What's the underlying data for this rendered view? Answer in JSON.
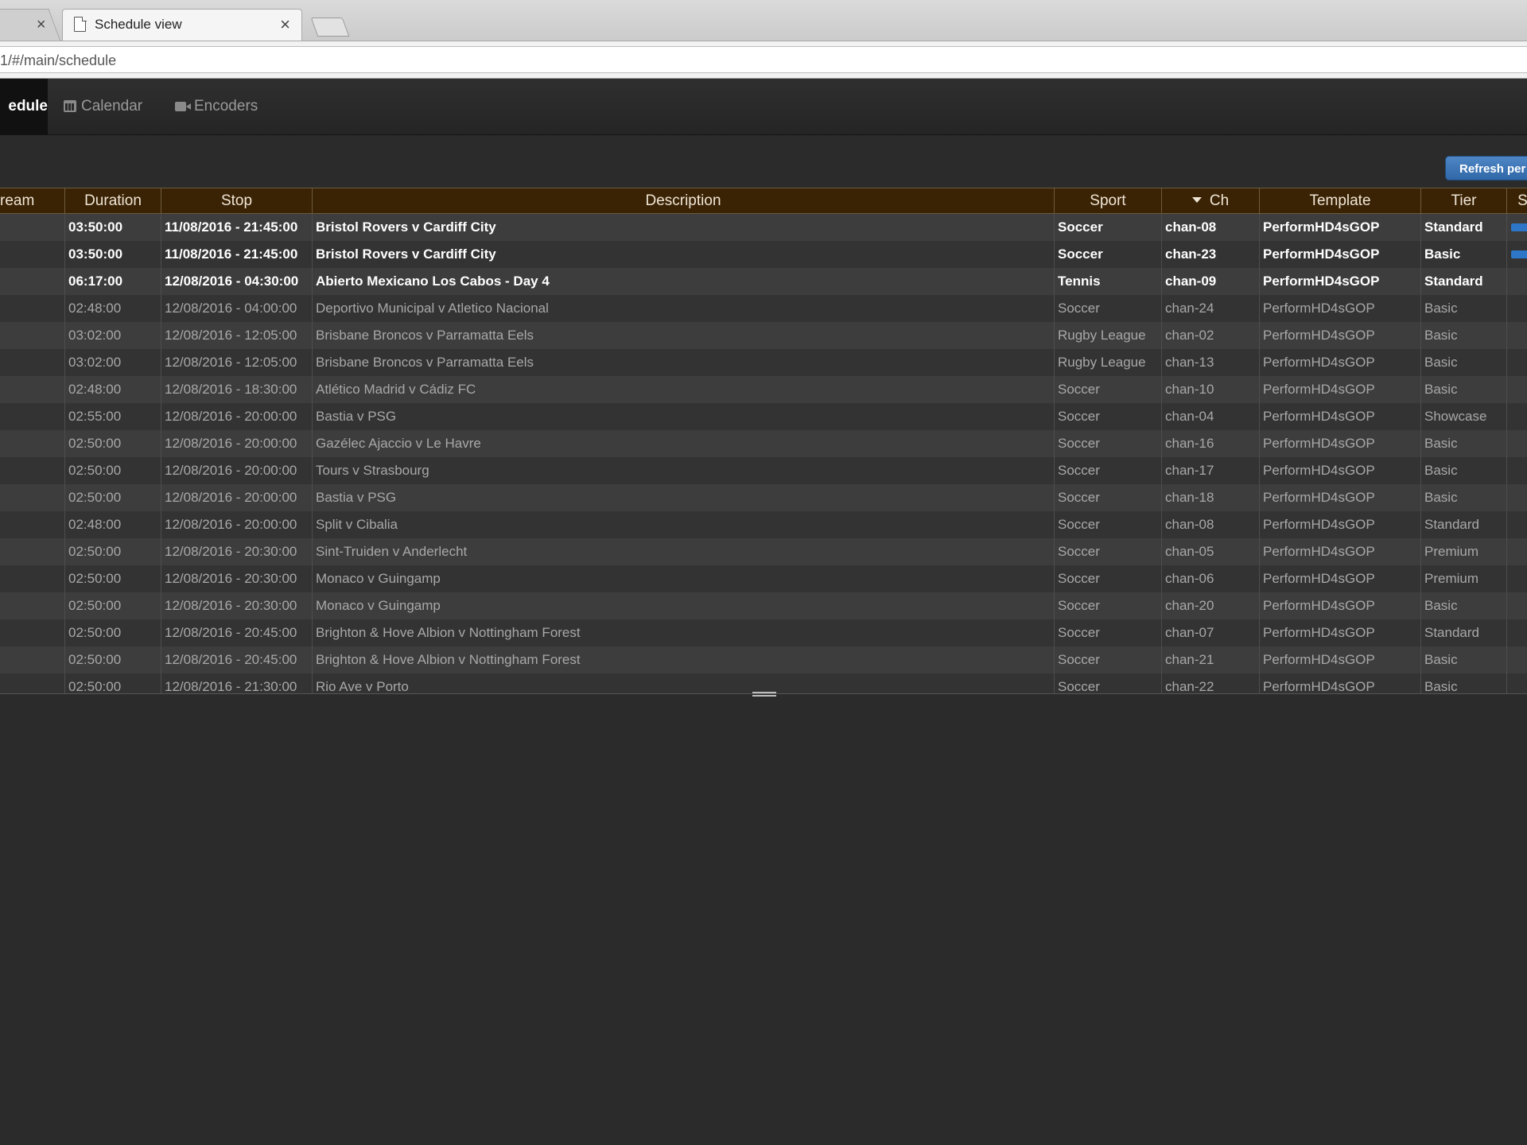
{
  "browser": {
    "tab_title": "Schedule view",
    "close_glyph": "×",
    "url": "1/#/main/schedule"
  },
  "nav": {
    "active": "edule",
    "calendar": "Calendar",
    "encoders": "Encoders",
    "calendar_icon": "calendar-icon",
    "encoders_icon": "video-camera-icon"
  },
  "toolbar": {
    "refresh_label": "Refresh per"
  },
  "table": {
    "headers": {
      "stream": "ream",
      "duration": "Duration",
      "stop": "Stop",
      "description": "Description",
      "sport": "Sport",
      "ch": "Ch",
      "template": "Template",
      "tier": "Tier",
      "s": "S"
    },
    "rows": [
      {
        "duration": "03:50:00",
        "stop": "11/08/2016 - 21:45:00",
        "description": "Bristol Rovers v Cardiff City",
        "sport": "Soccer",
        "ch": "chan-08",
        "template": "PerformHD4sGOP",
        "tier": "Standard"
      },
      {
        "duration": "03:50:00",
        "stop": "11/08/2016 - 21:45:00",
        "description": "Bristol Rovers v Cardiff City",
        "sport": "Soccer",
        "ch": "chan-23",
        "template": "PerformHD4sGOP",
        "tier": "Basic"
      },
      {
        "duration": "06:17:00",
        "stop": "12/08/2016 - 04:30:00",
        "description": "Abierto Mexicano Los Cabos - Day 4",
        "sport": "Tennis",
        "ch": "chan-09",
        "template": "PerformHD4sGOP",
        "tier": "Standard"
      },
      {
        "duration": "02:48:00",
        "stop": "12/08/2016 - 04:00:00",
        "description": "Deportivo Municipal v Atletico Nacional",
        "sport": "Soccer",
        "ch": "chan-24",
        "template": "PerformHD4sGOP",
        "tier": "Basic"
      },
      {
        "duration": "03:02:00",
        "stop": "12/08/2016 - 12:05:00",
        "description": "Brisbane Broncos v Parramatta Eels",
        "sport": "Rugby League",
        "ch": "chan-02",
        "template": "PerformHD4sGOP",
        "tier": "Basic"
      },
      {
        "duration": "03:02:00",
        "stop": "12/08/2016 - 12:05:00",
        "description": "Brisbane Broncos v Parramatta Eels",
        "sport": "Rugby League",
        "ch": "chan-13",
        "template": "PerformHD4sGOP",
        "tier": "Basic"
      },
      {
        "duration": "02:48:00",
        "stop": "12/08/2016 - 18:30:00",
        "description": "Atlético Madrid v Cádiz FC",
        "sport": "Soccer",
        "ch": "chan-10",
        "template": "PerformHD4sGOP",
        "tier": "Basic"
      },
      {
        "duration": "02:55:00",
        "stop": "12/08/2016 - 20:00:00",
        "description": "Bastia v PSG",
        "sport": "Soccer",
        "ch": "chan-04",
        "template": "PerformHD4sGOP",
        "tier": "Showcase"
      },
      {
        "duration": "02:50:00",
        "stop": "12/08/2016 - 20:00:00",
        "description": "Gazélec Ajaccio v Le Havre",
        "sport": "Soccer",
        "ch": "chan-16",
        "template": "PerformHD4sGOP",
        "tier": "Basic"
      },
      {
        "duration": "02:50:00",
        "stop": "12/08/2016 - 20:00:00",
        "description": "Tours v Strasbourg",
        "sport": "Soccer",
        "ch": "chan-17",
        "template": "PerformHD4sGOP",
        "tier": "Basic"
      },
      {
        "duration": "02:50:00",
        "stop": "12/08/2016 - 20:00:00",
        "description": "Bastia v PSG",
        "sport": "Soccer",
        "ch": "chan-18",
        "template": "PerformHD4sGOP",
        "tier": "Basic"
      },
      {
        "duration": "02:48:00",
        "stop": "12/08/2016 - 20:00:00",
        "description": "Split v Cibalia",
        "sport": "Soccer",
        "ch": "chan-08",
        "template": "PerformHD4sGOP",
        "tier": "Standard"
      },
      {
        "duration": "02:50:00",
        "stop": "12/08/2016 - 20:30:00",
        "description": "Sint-Truiden v Anderlecht",
        "sport": "Soccer",
        "ch": "chan-05",
        "template": "PerformHD4sGOP",
        "tier": "Premium"
      },
      {
        "duration": "02:50:00",
        "stop": "12/08/2016 - 20:30:00",
        "description": "Monaco v Guingamp",
        "sport": "Soccer",
        "ch": "chan-06",
        "template": "PerformHD4sGOP",
        "tier": "Premium"
      },
      {
        "duration": "02:50:00",
        "stop": "12/08/2016 - 20:30:00",
        "description": "Monaco v Guingamp",
        "sport": "Soccer",
        "ch": "chan-20",
        "template": "PerformHD4sGOP",
        "tier": "Basic"
      },
      {
        "duration": "02:50:00",
        "stop": "12/08/2016 - 20:45:00",
        "description": "Brighton & Hove Albion v Nottingham Forest",
        "sport": "Soccer",
        "ch": "chan-07",
        "template": "PerformHD4sGOP",
        "tier": "Standard"
      },
      {
        "duration": "02:50:00",
        "stop": "12/08/2016 - 20:45:00",
        "description": "Brighton & Hove Albion v Nottingham Forest",
        "sport": "Soccer",
        "ch": "chan-21",
        "template": "PerformHD4sGOP",
        "tier": "Basic"
      },
      {
        "duration": "02:50:00",
        "stop": "12/08/2016 - 21:30:00",
        "description": "Rio Ave v Porto",
        "sport": "Soccer",
        "ch": "chan-22",
        "template": "PerformHD4sGOP",
        "tier": "Basic"
      }
    ]
  },
  "colors": {
    "header_bg": "#3a2204",
    "accent_blue": "#2e77c8",
    "row_odd": "#3d3d3d",
    "row_even": "#333333"
  }
}
